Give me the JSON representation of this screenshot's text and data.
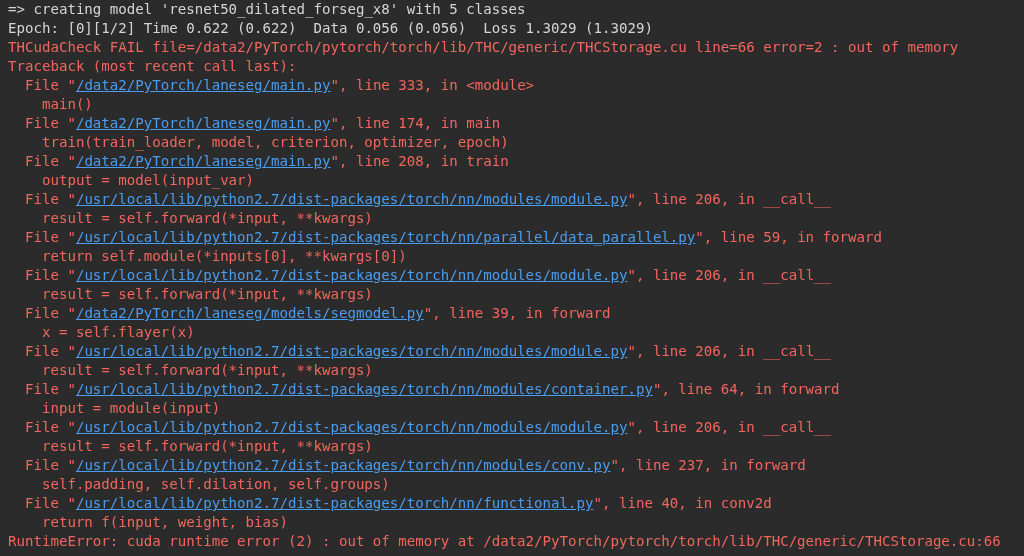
{
  "terminal": {
    "lines": [
      {
        "kind": "plain",
        "text": "=> creating model 'resnet50_dilated_forseg_x8' with 5 classes"
      },
      {
        "kind": "plain",
        "text": "Epoch: [0][1/2] Time 0.622 (0.622)  Data 0.056 (0.056)  Loss 1.3029 (1.3029)"
      },
      {
        "kind": "error",
        "text": "THCudaCheck FAIL file=/data2/PyTorch/pytorch/torch/lib/THC/generic/THCStorage.cu line=66 error=2 : out of memory"
      },
      {
        "kind": "error",
        "text": "Traceback (most recent call last):"
      },
      {
        "kind": "frame",
        "before": "File \"",
        "path": "/data2/PyTorch/laneseg/main.py",
        "after": "\", line 333, in <module>"
      },
      {
        "kind": "code",
        "text": "main()"
      },
      {
        "kind": "frame",
        "before": "File \"",
        "path": "/data2/PyTorch/laneseg/main.py",
        "after": "\", line 174, in main"
      },
      {
        "kind": "code",
        "text": "train(train_loader, model, criterion, optimizer, epoch)"
      },
      {
        "kind": "frame",
        "before": "File \"",
        "path": "/data2/PyTorch/laneseg/main.py",
        "after": "\", line 208, in train"
      },
      {
        "kind": "code",
        "text": "output = model(input_var)"
      },
      {
        "kind": "frame",
        "before": "File \"",
        "path": "/usr/local/lib/python2.7/dist-packages/torch/nn/modules/module.py",
        "after": "\", line 206, in __call__"
      },
      {
        "kind": "code",
        "text": "result = self.forward(*input, **kwargs)"
      },
      {
        "kind": "frame",
        "before": "File \"",
        "path": "/usr/local/lib/python2.7/dist-packages/torch/nn/parallel/data_parallel.py",
        "after": "\", line 59, in forward"
      },
      {
        "kind": "code",
        "text": "return self.module(*inputs[0], **kwargs[0])"
      },
      {
        "kind": "frame",
        "before": "File \"",
        "path": "/usr/local/lib/python2.7/dist-packages/torch/nn/modules/module.py",
        "after": "\", line 206, in __call__"
      },
      {
        "kind": "code",
        "text": "result = self.forward(*input, **kwargs)"
      },
      {
        "kind": "frame",
        "before": "File \"",
        "path": "/data2/PyTorch/laneseg/models/segmodel.py",
        "after": "\", line 39, in forward"
      },
      {
        "kind": "code",
        "text": "x = self.flayer(x)"
      },
      {
        "kind": "frame",
        "before": "File \"",
        "path": "/usr/local/lib/python2.7/dist-packages/torch/nn/modules/module.py",
        "after": "\", line 206, in __call__"
      },
      {
        "kind": "code",
        "text": "result = self.forward(*input, **kwargs)"
      },
      {
        "kind": "frame",
        "before": "File \"",
        "path": "/usr/local/lib/python2.7/dist-packages/torch/nn/modules/container.py",
        "after": "\", line 64, in forward"
      },
      {
        "kind": "code",
        "text": "input = module(input)"
      },
      {
        "kind": "frame",
        "before": "File \"",
        "path": "/usr/local/lib/python2.7/dist-packages/torch/nn/modules/module.py",
        "after": "\", line 206, in __call__"
      },
      {
        "kind": "code",
        "text": "result = self.forward(*input, **kwargs)"
      },
      {
        "kind": "frame",
        "before": "File \"",
        "path": "/usr/local/lib/python2.7/dist-packages/torch/nn/modules/conv.py",
        "after": "\", line 237, in forward"
      },
      {
        "kind": "code",
        "text": "self.padding, self.dilation, self.groups)"
      },
      {
        "kind": "frame",
        "before": "File \"",
        "path": "/usr/local/lib/python2.7/dist-packages/torch/nn/functional.py",
        "after": "\", line 40, in conv2d"
      },
      {
        "kind": "code",
        "text": "return f(input, weight, bias)"
      },
      {
        "kind": "error",
        "text": "RuntimeError: cuda runtime error (2) : out of memory at /data2/PyTorch/pytorch/torch/lib/THC/generic/THCStorage.cu:66"
      }
    ]
  }
}
